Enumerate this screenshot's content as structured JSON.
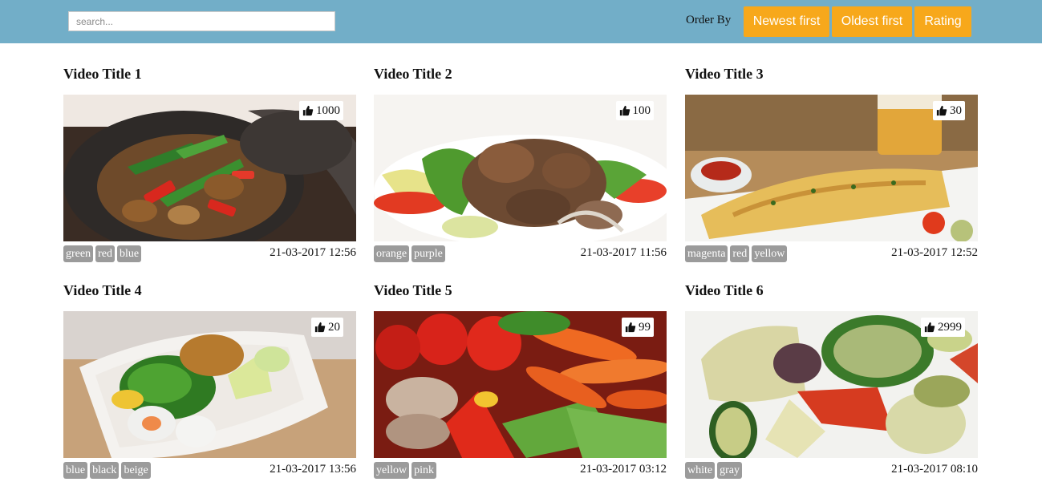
{
  "search": {
    "placeholder": "search..."
  },
  "order": {
    "label": "Order By",
    "buttons": [
      "Newest first",
      "Oldest first",
      "Rating"
    ]
  },
  "colors": {
    "header": "#72aec8",
    "button": "#f7a81b",
    "tag": "#9b9b9b"
  },
  "videos": [
    {
      "title": "Video Title 1",
      "likes": "1000",
      "tags": [
        "green",
        "red",
        "blue"
      ],
      "date": "21-03-2017 12:56"
    },
    {
      "title": "Video Title 2",
      "likes": "100",
      "tags": [
        "orange",
        "purple"
      ],
      "date": "21-03-2017 11:56"
    },
    {
      "title": "Video Title 3",
      "likes": "30",
      "tags": [
        "magenta",
        "red",
        "yellow"
      ],
      "date": "21-03-2017 12:52"
    },
    {
      "title": "Video Title 4",
      "likes": "20",
      "tags": [
        "blue",
        "black",
        "beige"
      ],
      "date": "21-03-2017 13:56"
    },
    {
      "title": "Video Title 5",
      "likes": "99",
      "tags": [
        "yellow",
        "pink"
      ],
      "date": "21-03-2017 03:12"
    },
    {
      "title": "Video Title 6",
      "likes": "2999",
      "tags": [
        "white",
        "gray"
      ],
      "date": "21-03-2017 08:10"
    }
  ]
}
